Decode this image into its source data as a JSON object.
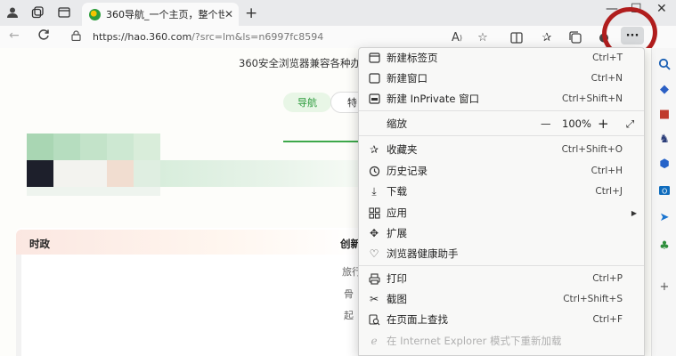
{
  "tab": {
    "title": "360导航_一个主页，整个世界"
  },
  "address_bar": {
    "url_host": "https://hao.360.com",
    "url_rest": "/?src=lm&ls=n6997fc8594"
  },
  "page": {
    "banner": "360安全浏览器兼容各种办公系",
    "pill_active": "导航",
    "pill_next": "特",
    "card_left": "时政",
    "card_right": "创新",
    "frag1": "旅行",
    "frag2": "骨",
    "frag3": "起"
  },
  "menu": {
    "new_tab": {
      "label": "新建标签页",
      "shortcut": "Ctrl+T"
    },
    "new_window": {
      "label": "新建窗口",
      "shortcut": "Ctrl+N"
    },
    "new_inprivate": {
      "label": "新建 InPrivate 窗口",
      "shortcut": "Ctrl+Shift+N"
    },
    "zoom": {
      "label": "缩放",
      "minus": "—",
      "value": "100%",
      "plus": "+"
    },
    "favorites": {
      "label": "收藏夹",
      "shortcut": "Ctrl+Shift+O"
    },
    "history": {
      "label": "历史记录",
      "shortcut": "Ctrl+H"
    },
    "downloads": {
      "label": "下载",
      "shortcut": "Ctrl+J"
    },
    "apps": {
      "label": "应用"
    },
    "extensions": {
      "label": "扩展"
    },
    "browser_health": {
      "label": "浏览器健康助手"
    },
    "print": {
      "label": "打印",
      "shortcut": "Ctrl+P"
    },
    "screenshot": {
      "label": "截图",
      "shortcut": "Ctrl+Shift+S"
    },
    "find": {
      "label": "在页面上查找",
      "shortcut": "Ctrl+F"
    },
    "ie_mode": {
      "label": "在 Internet Explorer 模式下重新加载"
    }
  },
  "colors": {
    "annotation_circle": "#b01d1d",
    "accent_green": "#2a9a3a"
  }
}
